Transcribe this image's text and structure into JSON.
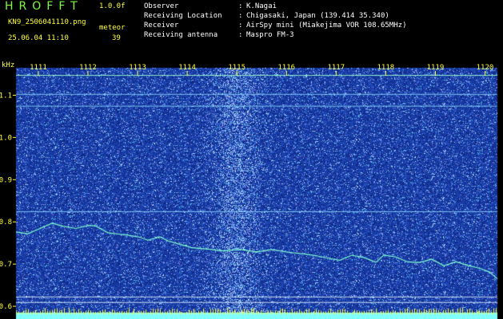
{
  "header": {
    "app_title": "HROFFT",
    "version": "1.0.0f",
    "filename": "KN9_2506041110.png",
    "meteor_label": "meteor",
    "datetime": "25.06.04 11:10",
    "meteor_count": "39",
    "info": [
      {
        "label": "Observer",
        "value": "K.Nagai"
      },
      {
        "label": "Receiving Location",
        "value": "Chigasaki, Japan (139.414 35.340)"
      },
      {
        "label": "Receiver",
        "value": "AirSpy mini (Miakejima VOR 108.65MHz)"
      },
      {
        "label": "Receiving antenna",
        "value": "Maspro FM-3"
      }
    ]
  },
  "spectrogram": {
    "y_unit": "kHz",
    "x_ticks": [
      "1111",
      "1112",
      "1113",
      "1114",
      "1115",
      "1116",
      "1117",
      "1118",
      "1119",
      "1120"
    ],
    "y_ticks": [
      "1.1",
      "1.0",
      "0.9",
      "0.8",
      "0.7",
      "0.6"
    ],
    "y_tick_values": [
      1.1,
      1.0,
      0.9,
      0.8,
      0.7,
      0.6
    ],
    "y_range": [
      0.585,
      1.165
    ],
    "x_range": [
      1110.55,
      1120.25
    ],
    "colors": {
      "background": "#1a2f9a",
      "noise": "#5a7fff",
      "signal": "#7fffd0",
      "grid_text": "#ffff3a",
      "meter": "#80ffff"
    }
  }
}
